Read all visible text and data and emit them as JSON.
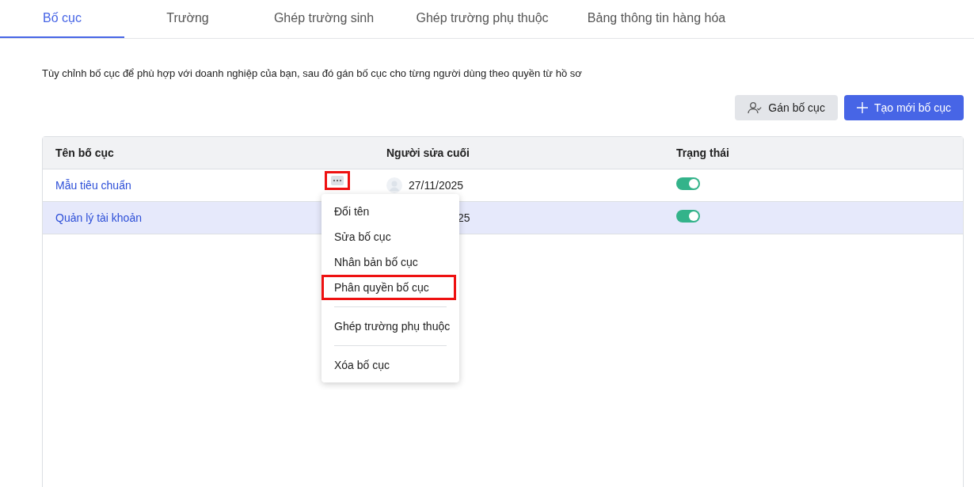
{
  "tabs": [
    {
      "label": "Bố cục",
      "selected": true
    },
    {
      "label": "Trường",
      "selected": false
    },
    {
      "label": "Ghép trường sinh",
      "selected": false
    },
    {
      "label": "Ghép trường phụ thuộc",
      "selected": false
    },
    {
      "label": "Bảng thông tin hàng hóa",
      "selected": false
    }
  ],
  "description": "Tùy chỉnh bố cục để phù hợp với doanh nghiệp của bạn, sau đó gán bố cục cho từng người dùng theo quyền từ hồ sơ",
  "buttons": [
    {
      "label": "Gán bố cục",
      "kind": "secondary"
    },
    {
      "label": "Tạo mới bố cục",
      "kind": "primary"
    }
  ],
  "table": {
    "columns": [
      "Tên bố cục",
      "Người sửa cuối",
      "Trạng thái"
    ],
    "rows": [
      {
        "name": "Mẫu tiêu chuẩn",
        "date": "27/11/2025",
        "avatar": true,
        "on": true,
        "selected": false,
        "menu_open": true
      },
      {
        "name": "Quản lý tài khoản",
        "date": "25",
        "avatar": false,
        "on": true,
        "selected": true,
        "menu_open": false
      }
    ]
  },
  "menu": {
    "items": [
      {
        "label": "Đổi tên",
        "divider_before": false,
        "highlighted": false
      },
      {
        "label": "Sửa bố cục",
        "divider_before": false,
        "highlighted": false
      },
      {
        "label": "Nhân bản bố cục",
        "divider_before": false,
        "highlighted": false
      },
      {
        "label": "Phân quyền bố cục",
        "divider_before": false,
        "highlighted": true
      },
      {
        "label": "Ghép trường phụ thuộc",
        "divider_before": true,
        "highlighted": false
      },
      {
        "label": "Xóa bố cục",
        "divider_before": true,
        "highlighted": false
      }
    ]
  }
}
